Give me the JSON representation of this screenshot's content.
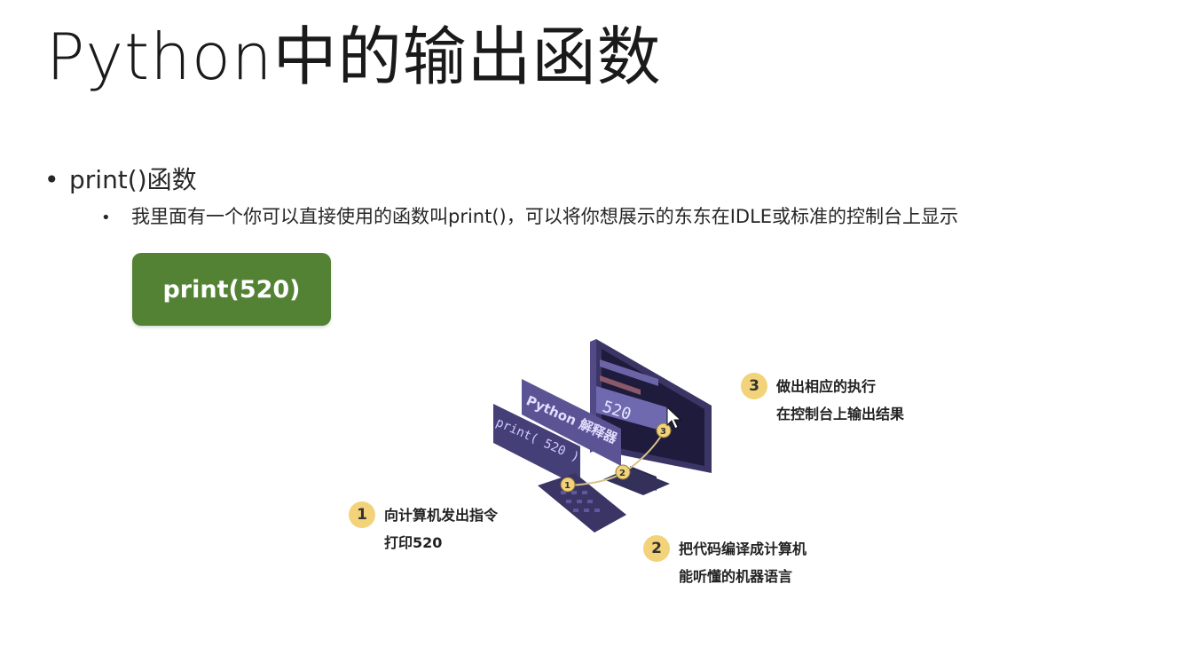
{
  "title": "Python中的输出函数",
  "bullet_level1": "print()函数",
  "bullet_level2": "我里面有一个你可以直接使用的函数叫print()，可以将你想展示的东东在IDLE或标准的控制台上显示",
  "code_box": "print(520)",
  "illustration": {
    "screen_value": "520",
    "panel_interpreter": "Python 解释器",
    "panel_code": "print( 520 )",
    "steps": [
      {
        "number": "1",
        "line1": "向计算机发出指令",
        "line2": "打印520"
      },
      {
        "number": "2",
        "line1": "把代码编译成计算机",
        "line2": "能听懂的机器语言"
      },
      {
        "number": "3",
        "line1": "做出相应的执行",
        "line2": "在控制台上输出结果"
      }
    ]
  },
  "colors": {
    "code_box_bg": "#548235",
    "monitor": "#3b3566",
    "step_badge": "#f3d37a"
  }
}
